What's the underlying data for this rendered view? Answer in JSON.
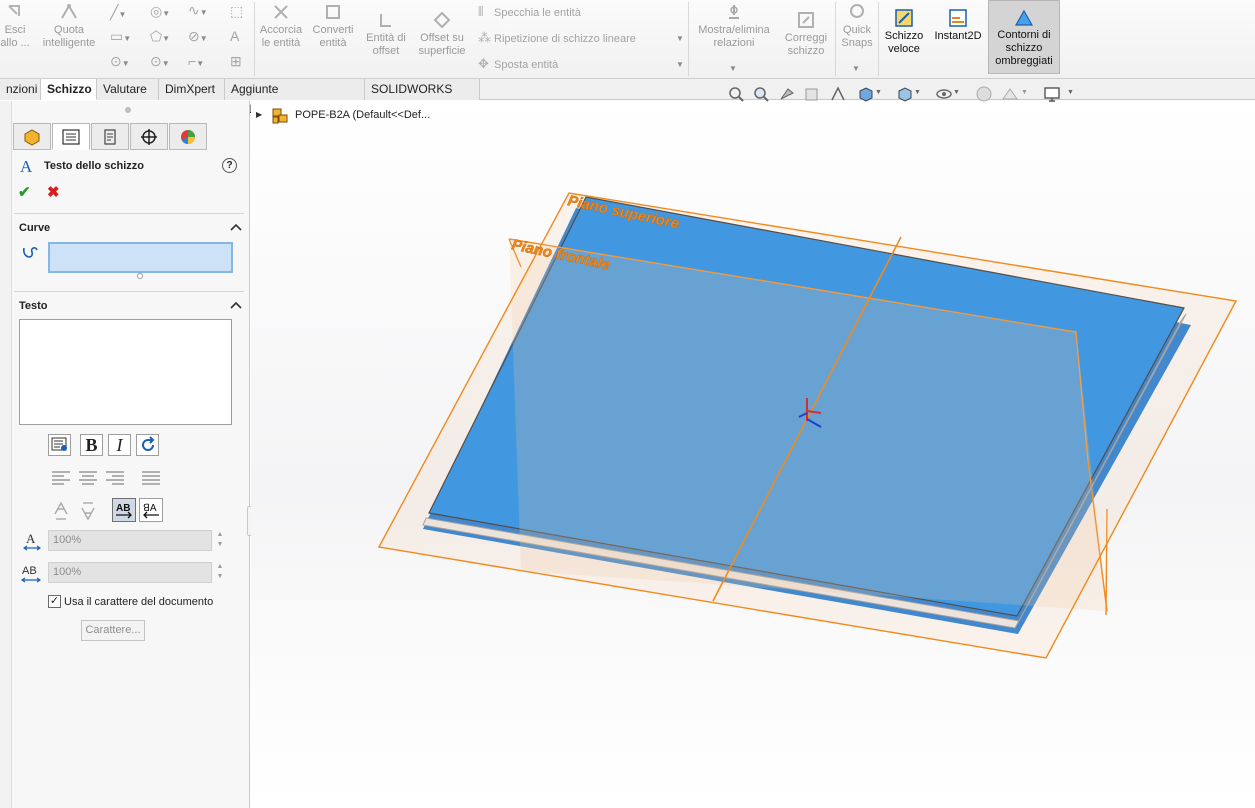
{
  "ribbon": {
    "esci": "Esci\nallo ...",
    "quota": "Quota\nintelligente",
    "accorcia": "Accorcia\nle entità",
    "converti": "Converti\nentità",
    "entita_offset": "Entità di\noffset",
    "offset_superficie": "Offset su\nsuperficie",
    "specchia": "Specchia le entità",
    "ripetizione": "Ripetizione di schizzo lineare",
    "sposta": "Sposta entità",
    "mostra": "Mostra/elimina\nrelazioni",
    "correggi": "Correggi\nschizzo",
    "quick_snaps": "Quick\nSnaps",
    "schizzo_veloce": "Schizzo\nveloce",
    "instant2d": "Instant2D",
    "contorni": "Contorni di\nschizzo\nombreggiati"
  },
  "tabs": [
    {
      "label": "nzioni"
    },
    {
      "label": "Schizzo"
    },
    {
      "label": "Valutare"
    },
    {
      "label": "DimXpert"
    },
    {
      "label": "Aggiunte SOLIDWORKS"
    },
    {
      "label": "SOLIDWORKS MBD"
    }
  ],
  "panel": {
    "title": "Testo dello schizzo",
    "curve_header": "Curve",
    "testo_header": "Testo",
    "width_value": "100%",
    "spacing_value": "100%",
    "use_doc_font_label": "Usa il carattere del documento",
    "use_doc_font_checked": true,
    "font_button": "Carattere...",
    "bold_glyph": "B",
    "italic_glyph": "I"
  },
  "tree": {
    "part_name": "POPE-B2A  (Default<<Def..."
  },
  "viewport": {
    "plane_top_label": "Piano superiore",
    "plane_front_label": "Piano frontale"
  },
  "colors": {
    "plane_orange": "#f08a1c",
    "face_blue": "#1a8ef0",
    "accent_ok": "#2e9a2e",
    "accent_cancel": "#d02020"
  }
}
